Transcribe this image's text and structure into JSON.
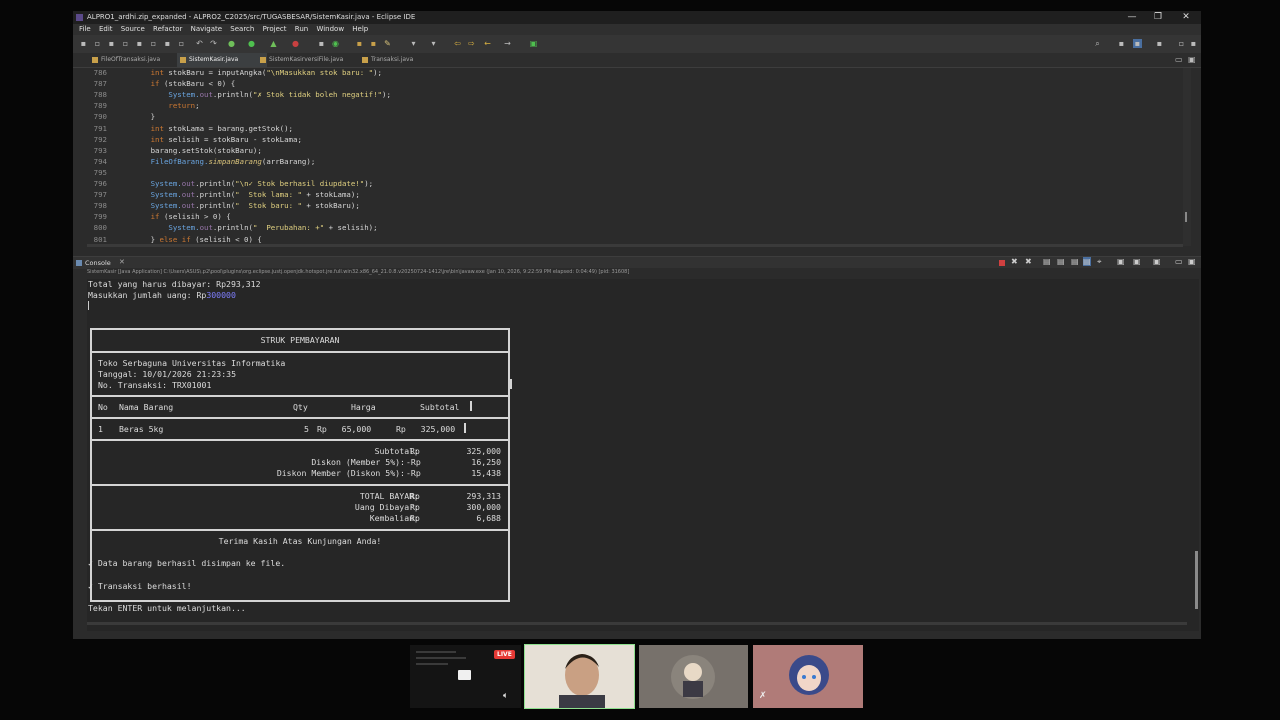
{
  "window": {
    "title": "ALPRO1_ardhi.zip_expanded - ALPRO2_C2025/src/TUGASBESAR/SistemKasir.java - Eclipse IDE",
    "controls": [
      "—",
      "❐",
      "✕"
    ]
  },
  "menu": [
    "File",
    "Edit",
    "Source",
    "Refactor",
    "Navigate",
    "Search",
    "Project",
    "Run",
    "Window",
    "Help"
  ],
  "tabs": [
    {
      "label": "FileOfTransaksi.java",
      "active": false
    },
    {
      "label": "SistemKasir.java",
      "active": true
    },
    {
      "label": "SistemKasirversiFile.java",
      "active": false
    },
    {
      "label": "Transaksi.java",
      "active": false
    }
  ],
  "editor": {
    "line_numbers": [
      "786",
      "787",
      "788",
      "789",
      "790",
      "791",
      "792",
      "793",
      "794",
      "795",
      "796",
      "797",
      "798",
      "799",
      "800",
      "801"
    ],
    "lines": [
      [
        [
          "        ",
          ""
        ],
        [
          "int",
          "kw"
        ],
        [
          " stokBaru = inputAngka(",
          ""
        ],
        [
          "\"\\nMasukkan stok baru: \"",
          "str"
        ],
        [
          ");",
          ""
        ]
      ],
      [
        [
          "        ",
          ""
        ],
        [
          "if",
          "kw"
        ],
        [
          " (stokBaru < 0) {",
          ""
        ]
      ],
      [
        [
          "            ",
          ""
        ],
        [
          "System.",
          "cls"
        ],
        [
          "out",
          "fld"
        ],
        [
          ".println(",
          ""
        ],
        [
          "\"✗ Stok tidak boleh negatif!\"",
          "str"
        ],
        [
          ");",
          ""
        ]
      ],
      [
        [
          "            ",
          ""
        ],
        [
          "return",
          "kw"
        ],
        [
          ";",
          ""
        ]
      ],
      [
        [
          "        }",
          ""
        ]
      ],
      [
        [
          "        ",
          ""
        ],
        [
          "int",
          "kw"
        ],
        [
          " stokLama = barang.getStok();",
          ""
        ]
      ],
      [
        [
          "        ",
          ""
        ],
        [
          "int",
          "kw"
        ],
        [
          " selisih = stokBaru - stokLama;",
          ""
        ]
      ],
      [
        [
          "        barang.setStok(stokBaru);",
          ""
        ]
      ],
      [
        [
          "        ",
          ""
        ],
        [
          "FileOfBarang.",
          "cls"
        ],
        [
          "simpanBarang",
          "mth"
        ],
        [
          "(arrBarang);",
          ""
        ]
      ],
      [
        [
          "",
          ""
        ]
      ],
      [
        [
          "        ",
          ""
        ],
        [
          "System.",
          "cls"
        ],
        [
          "out",
          "fld"
        ],
        [
          ".println(",
          ""
        ],
        [
          "\"\\n✓ Stok berhasil diupdate!\"",
          "str"
        ],
        [
          ");",
          ""
        ]
      ],
      [
        [
          "        ",
          ""
        ],
        [
          "System.",
          "cls"
        ],
        [
          "out",
          "fld"
        ],
        [
          ".println(",
          ""
        ],
        [
          "\"  Stok lama: \"",
          "str"
        ],
        [
          " + stokLama);",
          ""
        ]
      ],
      [
        [
          "        ",
          ""
        ],
        [
          "System.",
          "cls"
        ],
        [
          "out",
          "fld"
        ],
        [
          ".println(",
          ""
        ],
        [
          "\"  Stok baru: \"",
          "str"
        ],
        [
          " + stokBaru);",
          ""
        ]
      ],
      [
        [
          "        ",
          ""
        ],
        [
          "if",
          "kw"
        ],
        [
          " (selisih > 0) {",
          ""
        ]
      ],
      [
        [
          "            ",
          ""
        ],
        [
          "System.",
          "cls"
        ],
        [
          "out",
          "fld"
        ],
        [
          ".println(",
          ""
        ],
        [
          "\"  Perubahan: +\"",
          "str"
        ],
        [
          " + selisih);",
          ""
        ]
      ],
      [
        [
          "        } ",
          ""
        ],
        [
          "else if",
          "kw"
        ],
        [
          " (selisih < 0) {",
          ""
        ]
      ]
    ]
  },
  "console": {
    "tab_label": "Console",
    "launch_info": "SistemKasir [Java Application] C:\\Users\\ASUS\\.p2\\pool\\plugins\\org.eclipse.justj.openjdk.hotspot.jre.full.win32.x86_64_21.0.8.v20250724-1412\\jre\\bin\\javaw.exe (Jan 10, 2026, 9:22:59 PM elapsed: 0:04:49) [pid: 31608]",
    "total_line": "Total yang harus dibayar: Rp293,312",
    "input_prompt": "Masukkan jumlah uang: Rp",
    "input_value": "300000",
    "receipt": {
      "title": "STRUK PEMBAYARAN",
      "store": "Toko Serbaguna Universitas Informatika",
      "date": "Tanggal: 10/01/2026 21:23:35",
      "trx": "No. Transaksi: TRX01001",
      "headers": {
        "no": "No",
        "name": "Nama Barang",
        "qty": "Qty",
        "price": "Harga",
        "subtotal": "Subtotal"
      },
      "items": [
        {
          "no": "1",
          "name": "Beras 5kg",
          "qty": "5",
          "price": "Rp   65,000",
          "subtotal": "Rp   325,000"
        }
      ],
      "summary": [
        {
          "label": "Subtotal:",
          "cur": "Rp",
          "value": "325,000"
        },
        {
          "label": "Diskon (Member 5%):",
          "cur": "-Rp",
          "value": "16,250"
        },
        {
          "label": "Diskon Member (Diskon 5%):",
          "cur": "-Rp",
          "value": "15,438"
        }
      ],
      "totals": [
        {
          "label": "TOTAL BAYAR:",
          "cur": "Rp",
          "value": "293,313"
        },
        {
          "label": "Uang Dibayar:",
          "cur": "Rp",
          "value": "300,000"
        },
        {
          "label": "Kembalian:",
          "cur": "Rp",
          "value": "6,688"
        }
      ],
      "footer": "Terima Kasih Atas Kunjungan Anda!"
    },
    "saved_msg": "✓ Data barang berhasil disimpan ke file.",
    "trx_msg": "✓ Transaksi berhasil!",
    "continue_msg": "Tekan ENTER untuk melanjutkan...",
    "input_color": "#7f7fff"
  },
  "meeting": {
    "live_badge": "LIVE"
  }
}
